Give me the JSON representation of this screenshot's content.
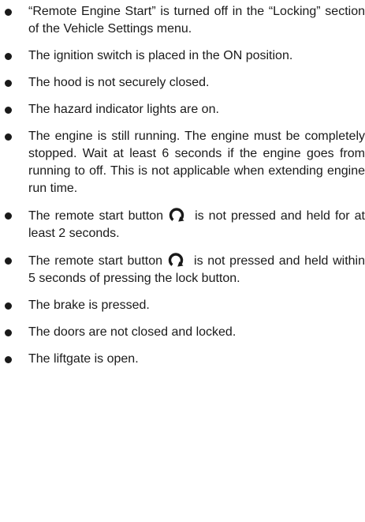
{
  "items": [
    {
      "text": "“Remote Engine Start” is turned off in the “Locking” section of the Vehicle Settings menu."
    },
    {
      "text": "The ignition switch is placed in the ON position."
    },
    {
      "text": "The hood is not securely closed."
    },
    {
      "text": "The hazard indicator lights are on."
    },
    {
      "text": "The engine is still running. The engine must be completely stopped. Wait at least 6 seconds if the engine goes from running to off. This is not applicable when extending engine run time."
    },
    {
      "text_before": "The remote start button",
      "icon": "remote-start-icon",
      "text_after": "is not pressed and held for at least 2 seconds."
    },
    {
      "text_before": "The remote start button",
      "icon": "remote-start-icon",
      "text_after": "is not pressed and held within 5 seconds of pressing the lock button."
    },
    {
      "text": "The brake is pressed."
    },
    {
      "text": "The doors are not closed and locked."
    },
    {
      "text": "The liftgate is open."
    }
  ],
  "colors": {
    "text": "#1a1a1a",
    "background": "#ffffff"
  }
}
